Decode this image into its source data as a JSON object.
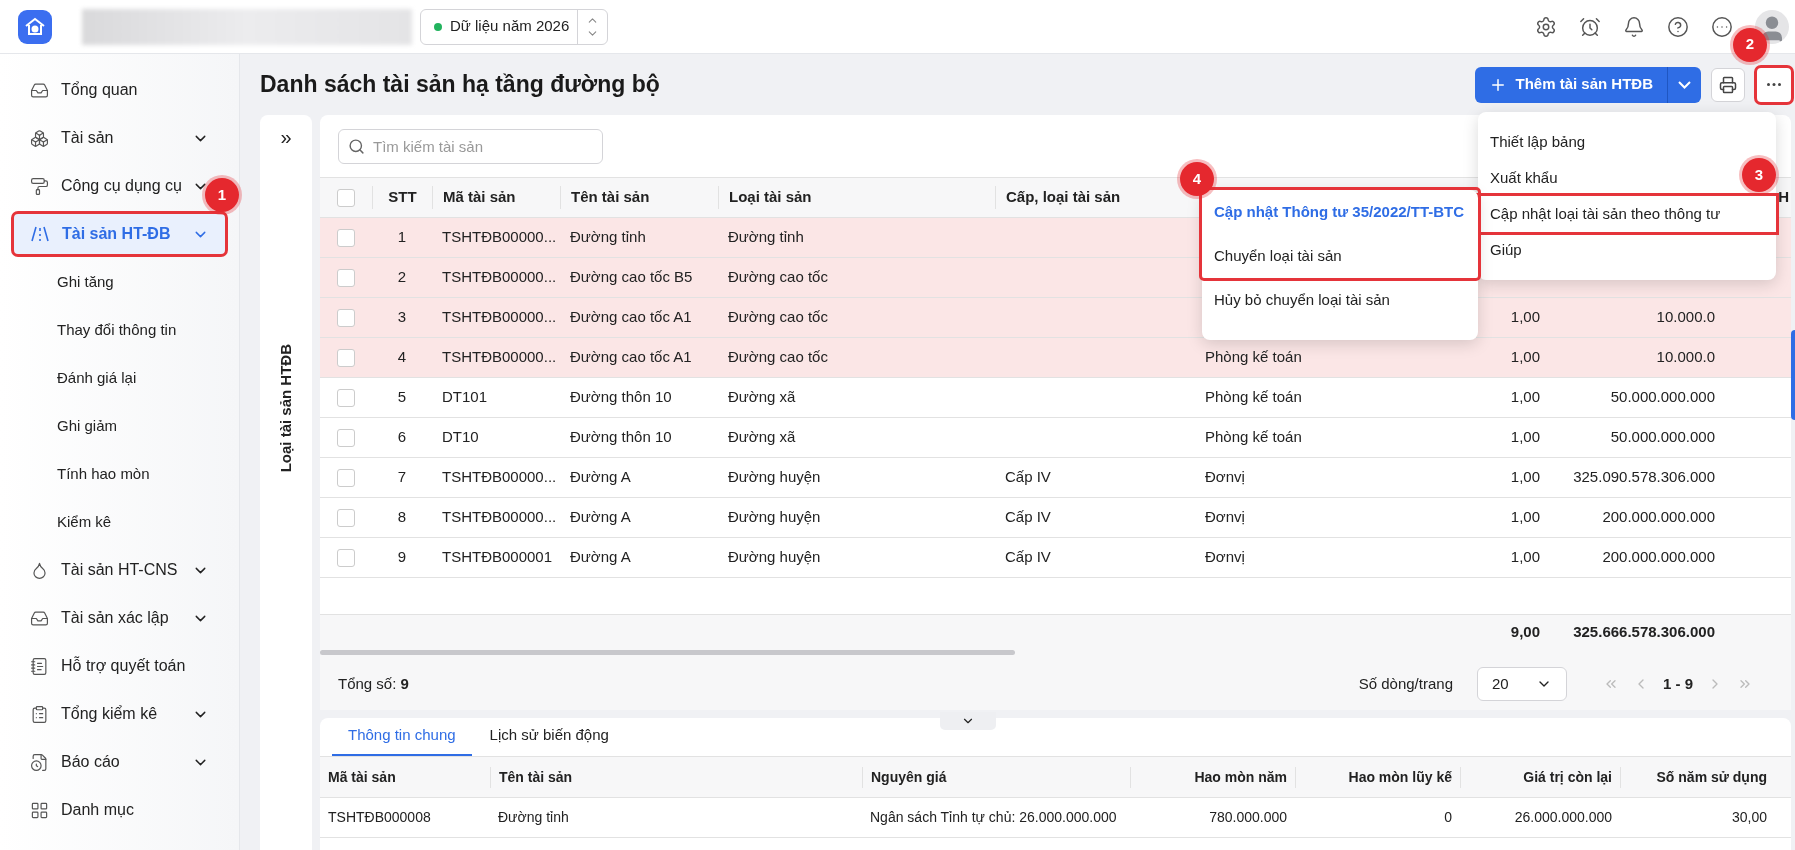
{
  "topbar": {
    "year_selector": {
      "label": "Dữ liệu năm 2026",
      "active": true
    }
  },
  "sidebar": {
    "items": [
      {
        "label": "Tổng quan",
        "expandable": false,
        "selected": false
      },
      {
        "label": "Tài sản",
        "expandable": true,
        "selected": false
      },
      {
        "label": "Công cụ dụng cụ",
        "expandable": true,
        "selected": false
      },
      {
        "label": "Tài sản HT-ĐB",
        "expandable": true,
        "selected": true,
        "callout": "1",
        "children": [
          {
            "label": "Ghi tăng"
          },
          {
            "label": "Thay đổi thông tin"
          },
          {
            "label": "Đánh giá lại"
          },
          {
            "label": "Ghi giảm"
          },
          {
            "label": "Tính hao mòn"
          },
          {
            "label": "Kiểm kê"
          }
        ]
      },
      {
        "label": "Tài sản HT-CNS",
        "expandable": true,
        "selected": false
      },
      {
        "label": "Tài sản xác lập",
        "expandable": true,
        "selected": false
      },
      {
        "label": "Hỗ trợ quyết toán",
        "expandable": false,
        "selected": false
      },
      {
        "label": "Tổng kiểm kê",
        "expandable": true,
        "selected": false
      },
      {
        "label": "Báo cáo",
        "expandable": true,
        "selected": false
      },
      {
        "label": "Danh mục",
        "expandable": false,
        "selected": false
      }
    ]
  },
  "page": {
    "title": "Danh sách tài sản hạ tầng đường bộ",
    "add_button": "Thêm tài sản HTĐB",
    "more_button": {
      "callout": "2"
    }
  },
  "more_menu": {
    "items": [
      {
        "label": "Thiết lập bảng"
      },
      {
        "label": "Xuất khẩu"
      },
      {
        "label": "Cập nhật loại tài sản theo thông tư",
        "callout": "3"
      },
      {
        "label": "Giúp"
      }
    ]
  },
  "submenu": {
    "callout": "4",
    "items": [
      {
        "label": "Cập nhật Thông tư 35/2022/TT-BTC",
        "selected": true,
        "boxed": true
      },
      {
        "label": "Chuyển loại tài sản",
        "selected": false,
        "boxed": true
      },
      {
        "label": "Hủy bỏ chuyển loại tài sản",
        "selected": false,
        "boxed": false
      }
    ]
  },
  "side_panel": {
    "toggle": "»",
    "title": "Loại tài sản HTĐB"
  },
  "search": {
    "placeholder": "Tìm kiếm tài sản"
  },
  "table": {
    "all_selected": false,
    "columns": [
      "STT",
      "Mã tài sản",
      "Tên tài sản",
      "Loại tài sản",
      "Cấp, loại tài sản"
    ],
    "cut_column": "H",
    "rows": [
      {
        "stt": "1",
        "code": "TSHTĐB00000...",
        "name": "Đường tỉnh",
        "type": "Đường tỉnh",
        "highlighted": true
      },
      {
        "stt": "2",
        "code": "TSHTĐB00000...",
        "name": "Đường cao tốc B5",
        "type": "Đường cao tốc",
        "highlighted": true
      },
      {
        "stt": "3",
        "code": "TSHTĐB00000...",
        "name": "Đường cao tốc A1",
        "type": "Đường cao tốc",
        "qty": "1,00",
        "value": "10.000.0",
        "highlighted": true
      },
      {
        "stt": "4",
        "code": "TSHTĐB00000...",
        "name": "Đường cao tốc A1",
        "type": "Đường cao tốc",
        "dept": "Phòng kế toán",
        "qty": "1,00",
        "value": "10.000.0",
        "highlighted": true
      },
      {
        "stt": "5",
        "code": "DT101",
        "name": "Đường thôn 10",
        "type": "Đường xã",
        "dept": "Phòng kế toán",
        "qty": "1,00",
        "value": "50.000.000.000",
        "highlighted": false
      },
      {
        "stt": "6",
        "code": "DT10",
        "name": "Đường thôn 10",
        "type": "Đường xã",
        "dept": "Phòng kế toán",
        "qty": "1,00",
        "value": "50.000.000.000",
        "highlighted": false
      },
      {
        "stt": "7",
        "code": "TSHTĐB00000...",
        "name": "Đường A",
        "type": "Đường huyện",
        "level": "Cấp IV",
        "dept": "Đơnvị",
        "qty": "1,00",
        "value": "325.090.578.306.000",
        "highlighted": false
      },
      {
        "stt": "8",
        "code": "TSHTĐB00000...",
        "name": "Đường A",
        "type": "Đường huyện",
        "level": "Cấp IV",
        "dept": "Đơnvị",
        "qty": "1,00",
        "value": "200.000.000.000",
        "highlighted": false
      },
      {
        "stt": "9",
        "code": "TSHTĐB000001",
        "name": "Đường A",
        "type": "Đường huyện",
        "level": "Cấp IV",
        "dept": "Đơnvị",
        "qty": "1,00",
        "value": "200.000.000.000",
        "highlighted": false
      }
    ],
    "totals": {
      "qty": "9,00",
      "value": "325.666.578.306.000"
    }
  },
  "pagination": {
    "total": "Tổng số: **9**",
    "rows_per_page_label": "Số dòng/trang",
    "rows_per_page": "20",
    "range": "1 - 9"
  },
  "detail": {
    "tabs": [
      {
        "label": "Thông tin chung",
        "selected": true
      },
      {
        "label": "Lịch sử biến động",
        "selected": false
      }
    ],
    "columns": [
      "Mã tài sản",
      "Tên tài sản",
      "Nguyên giá",
      "Hao mòn năm",
      "Hao mòn lũy kế",
      "Giá trị còn lại",
      "Số năm sử dụng"
    ],
    "rows": [
      [
        "TSHTĐB000008",
        "Đường tỉnh",
        "Ngân sách Tỉnh tự chủ: 26.000.000.000",
        "780.000.000",
        "0",
        "26.000.000.000",
        "30,00"
      ]
    ]
  }
}
